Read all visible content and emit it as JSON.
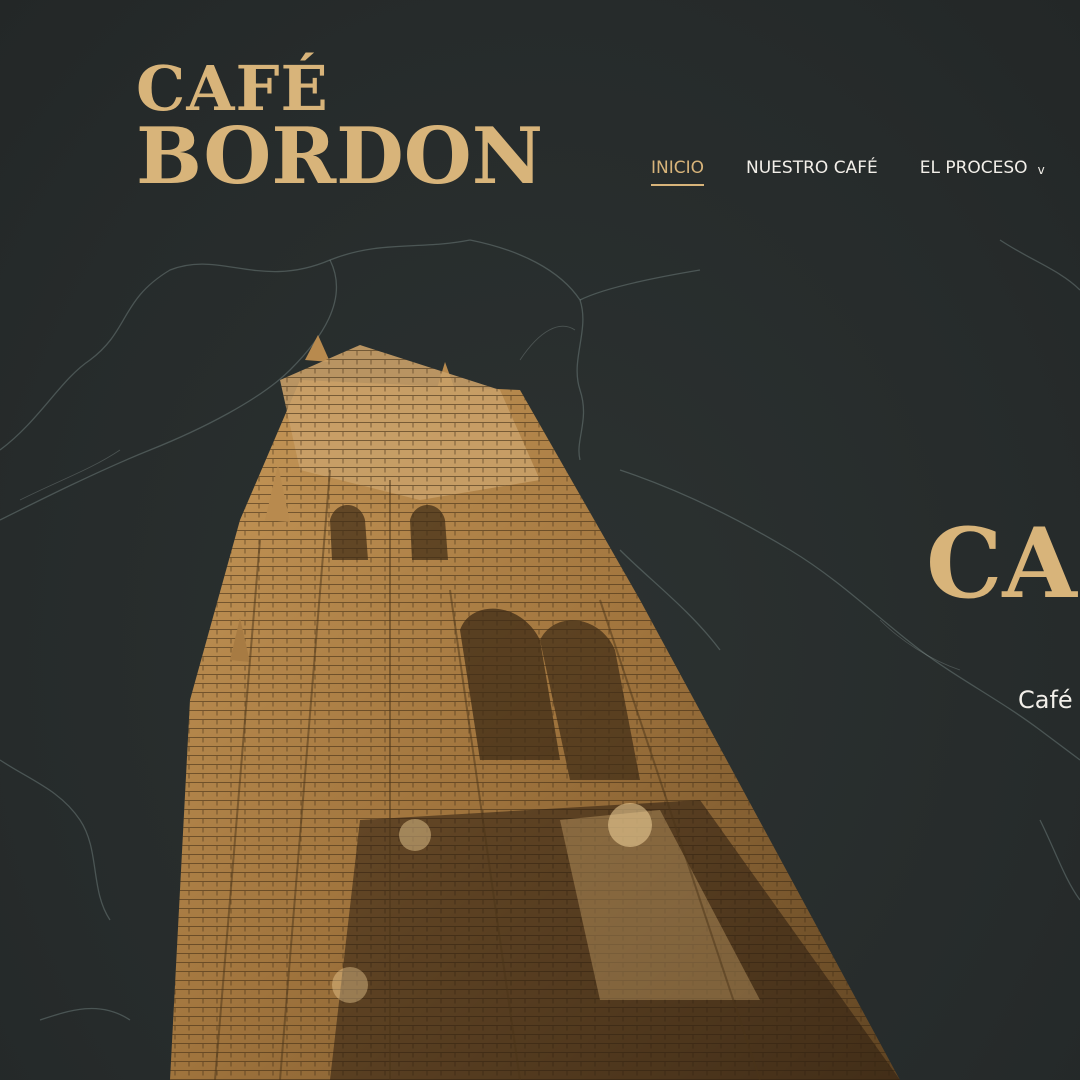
{
  "logo": {
    "line1": "CAFÉ",
    "line2": "BORDON"
  },
  "nav": {
    "items": [
      {
        "label": "INICIO",
        "active": true
      },
      {
        "label": "NUESTRO CAFÉ",
        "active": false
      },
      {
        "label": "EL PROCESO",
        "active": false,
        "dropdown_icon": "chevron-down-icon"
      }
    ]
  },
  "hero": {
    "title": "CAFÉ BORDON",
    "subtitle": "Café"
  },
  "colors": {
    "background": "#2a2e2e",
    "accent": "#d8b47a",
    "text": "#f2efe9"
  }
}
